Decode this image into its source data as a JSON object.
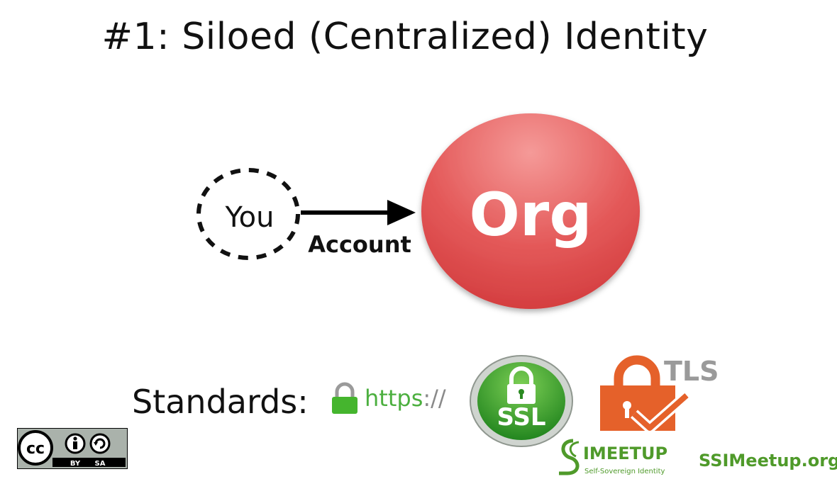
{
  "slide": {
    "title": "#1: Siloed (Centralized) Identity",
    "standards_label": "Standards:"
  },
  "diagram": {
    "you_label": "You",
    "arrow_label": "Account",
    "org_label": "Org",
    "org_color": "#e0484a"
  },
  "standards": {
    "https_text": "https",
    "https_slashes": "://",
    "ssl_label": "SSL",
    "tls_label": "TLS"
  },
  "license": {
    "cc_label": "cc",
    "by_label": "BY",
    "sa_label": "SA"
  },
  "footer": {
    "meetup_name": "IMEETUP",
    "meetup_tagline": "Self-Sovereign Identity",
    "url": "SSIMeetup.org"
  },
  "colors": {
    "green": "#4caf3f",
    "tls_orange": "#e5612a",
    "gray": "#9a9a9a"
  }
}
